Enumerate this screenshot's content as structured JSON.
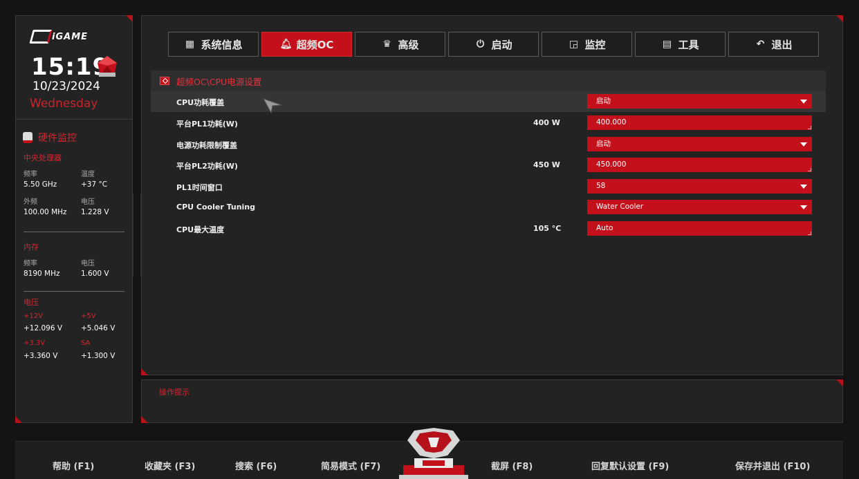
{
  "sidebar": {
    "brand": "iGAME",
    "time": "15:19",
    "date": "10/23/2024",
    "weekday": "Wednesday",
    "hw_title": "硬件监控",
    "cpu": {
      "title": "中央处理器",
      "freq_label": "频率",
      "freq_value": "5.50 GHz",
      "temp_label": "温度",
      "temp_value": "+37 °C",
      "bclk_label": "外频",
      "bclk_value": "100.00 MHz",
      "volt_label": "电压",
      "volt_value": "1.228 V"
    },
    "memory": {
      "title": "内存",
      "freq_label": "频率",
      "freq_value": "8190 MHz",
      "volt_label": "电压",
      "volt_value": "1.600 V"
    },
    "voltage": {
      "title": "电压",
      "v12_label": "+12V",
      "v12_value": "+12.096 V",
      "v5_label": "+5V",
      "v5_value": "+5.046 V",
      "v33_label": "+3.3V",
      "v33_value": "+3.360 V",
      "sa_label": "SA",
      "sa_value": "+1.300 V"
    }
  },
  "tabs": [
    {
      "label": "系统信息",
      "icon": "grid-icon",
      "active": false
    },
    {
      "label": "超频OC",
      "icon": "bell-icon",
      "active": true
    },
    {
      "label": "高级",
      "icon": "crown-icon",
      "active": false
    },
    {
      "label": "启动",
      "icon": "power-icon",
      "active": false
    },
    {
      "label": "监控",
      "icon": "pulse-icon",
      "active": false
    },
    {
      "label": "工具",
      "icon": "toolbox-icon",
      "active": false
    },
    {
      "label": "退出",
      "icon": "back-arrow-icon",
      "active": false
    }
  ],
  "breadcrumb": "超频OC\\CPU电源设置",
  "settings": [
    {
      "name": "CPU功耗覆盖",
      "current": "",
      "value": "启动",
      "type": "dropdown"
    },
    {
      "name": "平台PL1功耗(W)",
      "current": "400 W",
      "value": "400.000",
      "type": "input"
    },
    {
      "name": "电源功耗限制覆盖",
      "current": "",
      "value": "启动",
      "type": "dropdown"
    },
    {
      "name": "平台PL2功耗(W)",
      "current": "450 W",
      "value": "450.000",
      "type": "input"
    },
    {
      "name": "PL1时间窗口",
      "current": "",
      "value": "58",
      "type": "dropdown"
    },
    {
      "name": "CPU Cooler Tuning",
      "current": "",
      "value": "Water Cooler",
      "type": "dropdown"
    },
    {
      "name": "CPU最大温度",
      "current": "105 °C",
      "value": "Auto",
      "type": "input"
    }
  ],
  "help": {
    "title": "操作提示"
  },
  "footer": {
    "help": "帮助 (F1)",
    "favorites": "收藏夹 (F3)",
    "search": "搜索 (F6)",
    "easy_mode": "简易模式 (F7)",
    "screenshot": "截屏 (F8)",
    "restore_defaults": "回复默认设置 (F9)",
    "save_exit": "保存并退出 (F10)"
  },
  "colors": {
    "accent": "#c4101a",
    "panel": "#232323",
    "background": "#141414"
  }
}
